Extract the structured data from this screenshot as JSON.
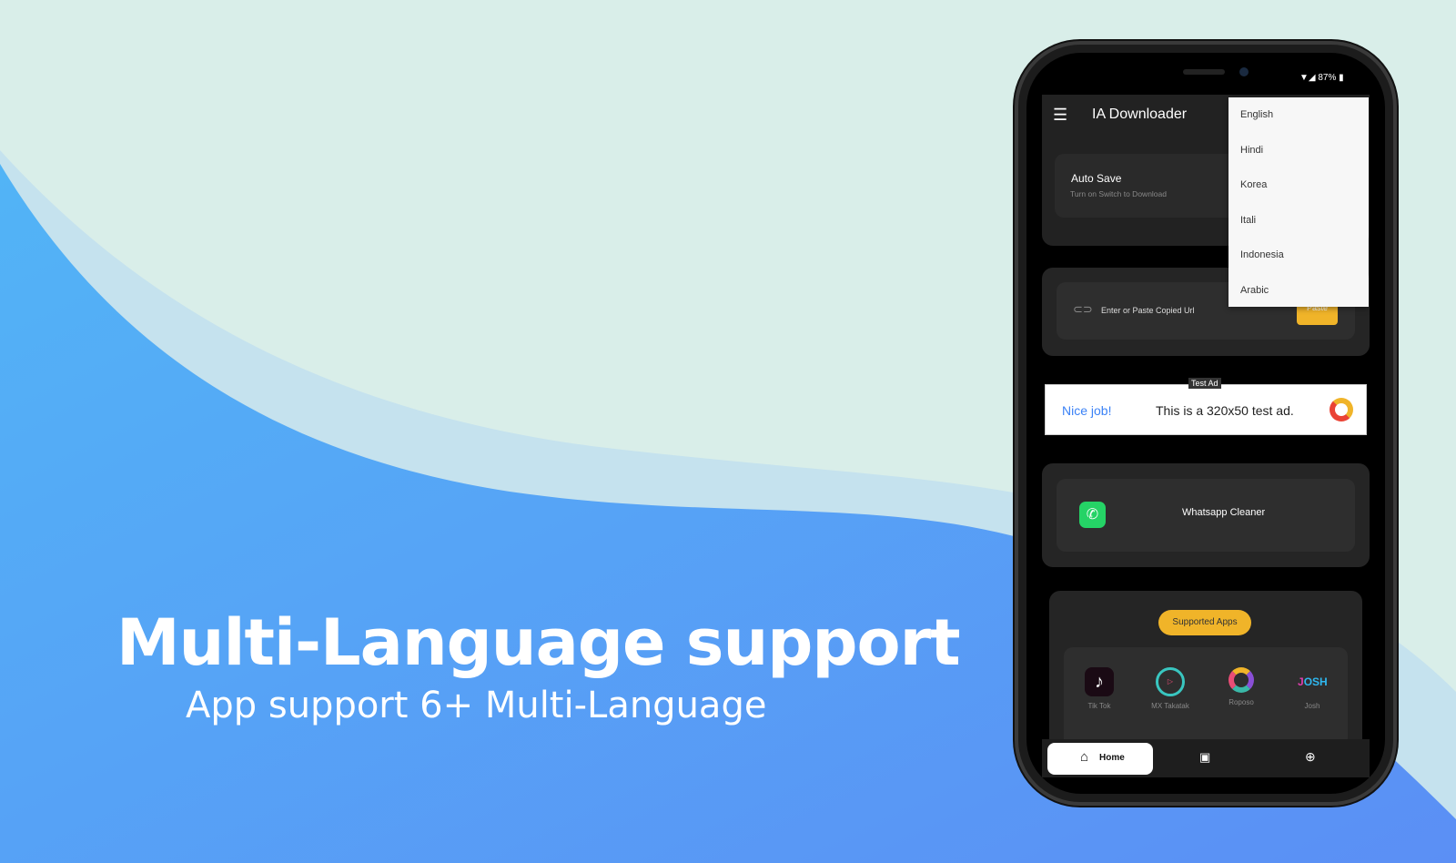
{
  "promo": {
    "headline": "Multi-Language support",
    "subheadline": "App support 6+ Multi-Language"
  },
  "status_bar": {
    "battery": "87%"
  },
  "app_bar": {
    "title": "IA Downloader",
    "menu_icon": "hamburger-icon"
  },
  "auto_save": {
    "title": "Auto Save",
    "subtitle": "Turn on Switch to Download"
  },
  "url_input": {
    "placeholder": "Enter or Paste Copied Url",
    "paste_label": "Paste"
  },
  "language_menu": {
    "options": [
      "English",
      "Hindi",
      "Korea",
      "Itali",
      "Indonesia",
      "Arabic"
    ]
  },
  "ad": {
    "badge": "Test Ad",
    "left_text": "Nice job!",
    "text": "This is a 320x50 test ad."
  },
  "whatsapp_cleaner": {
    "label": "Whatsapp Cleaner"
  },
  "supported_apps": {
    "title": "Supported Apps",
    "apps": [
      {
        "name": "Tik Tok"
      },
      {
        "name": "MX Takatak"
      },
      {
        "name": "Roposo"
      },
      {
        "name": "Josh"
      }
    ]
  },
  "bottom_nav": {
    "home": "Home"
  },
  "colors": {
    "accent": "#f0b429",
    "background_top": "#d9eee9",
    "blue": "#52a8f5"
  }
}
